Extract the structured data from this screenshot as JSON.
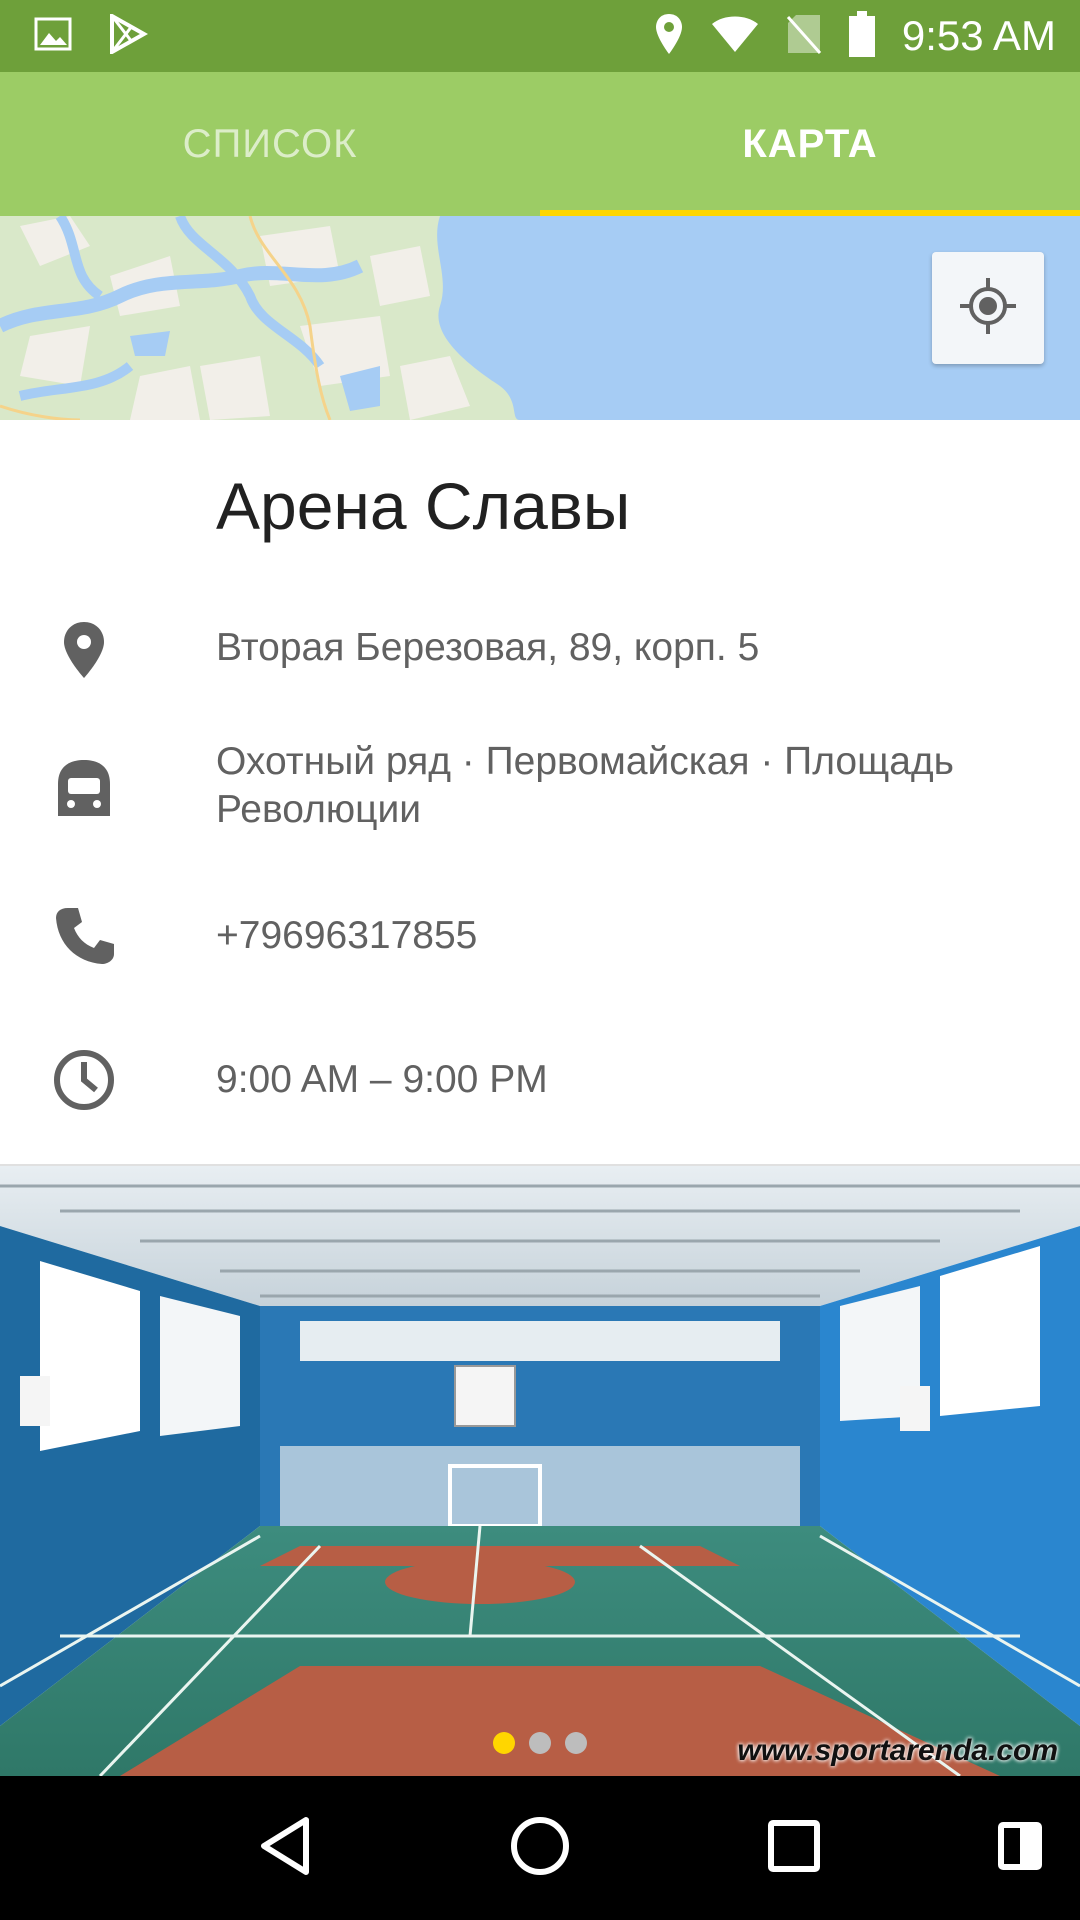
{
  "status_bar": {
    "time": "9:53 AM",
    "icons": [
      "image-icon",
      "play-store-icon",
      "location-icon",
      "wifi-icon",
      "no-sim-icon",
      "battery-icon"
    ]
  },
  "tabs": [
    {
      "label": "СПИСОК",
      "active": false
    },
    {
      "label": "КАРТА",
      "active": true
    }
  ],
  "map": {
    "locate_button_icon": "my-location-icon"
  },
  "place": {
    "name": "Арена Славы",
    "address": "Вторая Березовая, 89, корп. 5",
    "metro": "Охотный ряд · Первомайская · Площадь Революции",
    "phone": "+79696317855",
    "hours": "9:00 AM – 9:00 PM"
  },
  "photo": {
    "watermark": "www.sportarenda.com",
    "page_count": 3,
    "current_page": 1
  },
  "nav_bar": {
    "icons": [
      "back-icon",
      "home-icon",
      "recents-icon",
      "split-screen-icon"
    ]
  },
  "colors": {
    "status_bar": "#6ea03a",
    "tab_bar": "#9ccc65",
    "tab_indicator": "#ffd600",
    "water": "#a6ccf4"
  }
}
